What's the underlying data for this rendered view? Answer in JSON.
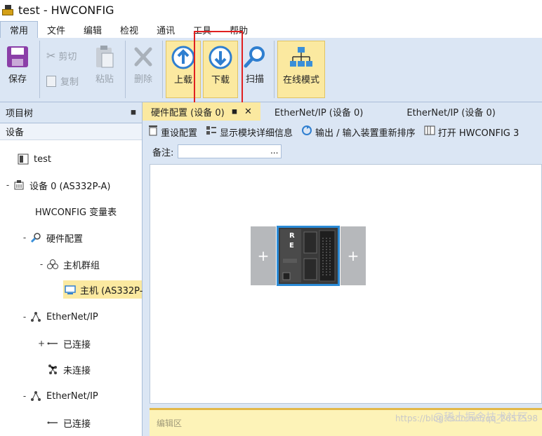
{
  "window": {
    "title": "test - HWCONFIG"
  },
  "menu": {
    "tabs": [
      "常用",
      "文件",
      "编辑",
      "检视",
      "通讯",
      "工具",
      "帮助"
    ]
  },
  "ribbon": {
    "save": "保存",
    "cut": "剪切",
    "copy": "复制",
    "paste": "粘贴",
    "delete": "删除",
    "upload": "上载",
    "download": "下载",
    "scan": "扫描",
    "online_mode": "在线模式"
  },
  "left_panel": {
    "title": "项目树",
    "subheader": "设备",
    "tree": [
      {
        "label": "test",
        "expander": "",
        "icon": "project-icon"
      },
      {
        "label": "设备 0 (AS332P-A)",
        "expander": "-",
        "icon": "device-icon"
      },
      {
        "label": "HWCONFIG 变量表",
        "expander": "",
        "icon": ""
      },
      {
        "label": "硬件配置",
        "expander": "-",
        "icon": "hardware-config-icon"
      },
      {
        "label": "主机群组",
        "expander": "-",
        "icon": "host-group-icon"
      },
      {
        "label": "主机 (AS332P-",
        "expander": "",
        "icon": "host-icon"
      },
      {
        "label": "EtherNet/IP",
        "expander": "-",
        "icon": "network-icon"
      },
      {
        "label": "已连接",
        "expander": "+",
        "icon": "connected-icon"
      },
      {
        "label": "未连接",
        "expander": "",
        "icon": "unconnected-icon"
      },
      {
        "label": "EtherNet/IP",
        "expander": "-",
        "icon": "network-icon"
      },
      {
        "label": "已连接",
        "expander": "",
        "icon": "connected-icon"
      }
    ]
  },
  "doc": {
    "tabs": [
      "硬件配置 (设备 0)",
      "EtherNet/IP (设备 0)",
      "EtherNet/IP (设备 0)"
    ],
    "toolbar": {
      "reset": "重设配置",
      "show_detail": "显示模块详细信息",
      "reorder": "输出 / 输入装置重新排序",
      "open_hwconfig": "打开 HWCONFIG 3"
    },
    "note_label": "备注:",
    "note_button": "...",
    "slot_symbol": "+",
    "module_labels": [
      "R",
      "E"
    ],
    "editor_label": "编辑区",
    "watermark": "@稀土掘金技术社区",
    "watermark_url": "https://blog.csdn.net/qq_2657598"
  },
  "colors": {
    "ribbon_bg": "#dbe6f4",
    "highlight": "#fbe9a0",
    "red_box": "#e02020",
    "module_border": "#2a8ad6"
  }
}
